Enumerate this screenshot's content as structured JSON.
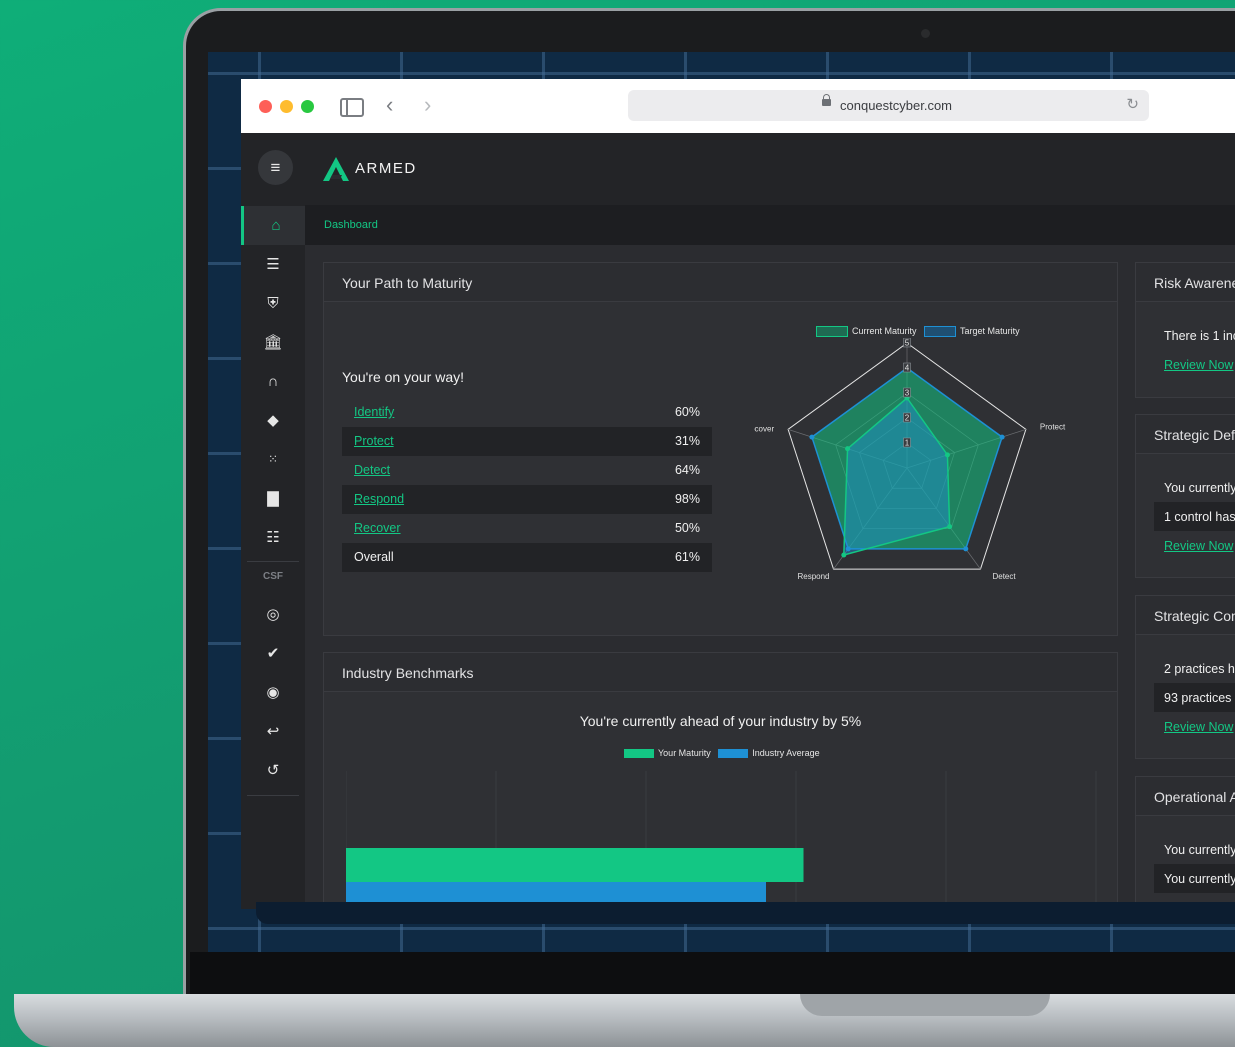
{
  "browser": {
    "url": "conquestcyber.com"
  },
  "app": {
    "brand": "ARMED",
    "breadcrumb": "Dashboard",
    "nav_section_label": "CSF",
    "nav_icons": [
      "home-icon",
      "server-icon",
      "shield-icon",
      "bank-icon",
      "headset-icon",
      "book-icon",
      "dots-grid-icon",
      "bar-chart-icon",
      "list-icon"
    ],
    "csf_icons": [
      "fingerprint-icon",
      "shield-check-icon",
      "radar-icon",
      "reply-icon",
      "history-icon"
    ]
  },
  "maturity": {
    "title": "Your Path to Maturity",
    "subtitle": "You're on your way!",
    "rows": [
      {
        "label": "Identify",
        "value": "60%"
      },
      {
        "label": "Protect",
        "value": "31%"
      },
      {
        "label": "Detect",
        "value": "64%"
      },
      {
        "label": "Respond",
        "value": "98%"
      },
      {
        "label": "Recover",
        "value": "50%"
      },
      {
        "label": "Overall",
        "value": "61%"
      }
    ],
    "radar_legend": {
      "current": "Current Maturity",
      "target": "Target Maturity"
    },
    "radar_axes": [
      "Identify",
      "Protect",
      "Detect",
      "Respond",
      "Recover"
    ],
    "radar_ticks": [
      "5",
      "4",
      "3",
      "2",
      "1"
    ]
  },
  "chart_data": [
    {
      "type": "radar",
      "categories": [
        "Identify",
        "Protect",
        "Detect",
        "Respond",
        "Recover"
      ],
      "range": [
        0,
        5
      ],
      "series": [
        {
          "name": "Current Maturity",
          "values": [
            2.8,
            1.7,
            2.9,
            4.3,
            2.5
          ],
          "color": "#13c784"
        },
        {
          "name": "Target Maturity",
          "values": [
            4.0,
            4.0,
            4.0,
            4.0,
            4.0
          ],
          "color": "#1e90d4"
        }
      ],
      "legend": "top"
    },
    {
      "type": "bar",
      "orientation": "horizontal",
      "title": "You're currently ahead of your industry by 5%",
      "series": [
        {
          "name": "Your Maturity",
          "value": 61,
          "color": "#13c784"
        },
        {
          "name": "Industry Average",
          "value": 56,
          "color": "#1e90d4"
        }
      ],
      "xlim": [
        0,
        100
      ],
      "grid": true,
      "legend": "top"
    }
  ],
  "benchmarks": {
    "title": "Industry Benchmarks",
    "subtitle": "You're currently ahead of your industry by 5%",
    "legend_yours": "Your Maturity",
    "legend_avg": "Industry Average"
  },
  "right_panels": {
    "risk": {
      "title": "Risk Awarene",
      "line1": "There is 1 inc",
      "link": "Review Now"
    },
    "defense": {
      "title": "Strategic Defe",
      "line1": "You currently",
      "line2": "1 control has",
      "link": "Review Now"
    },
    "compliance": {
      "title": "Strategic Com",
      "line1": "2 practices ha",
      "line2": "93 practices r",
      "link": "Review Now"
    },
    "operational": {
      "title": "Operational A",
      "line1": "You currently",
      "line2": "You currently"
    }
  }
}
